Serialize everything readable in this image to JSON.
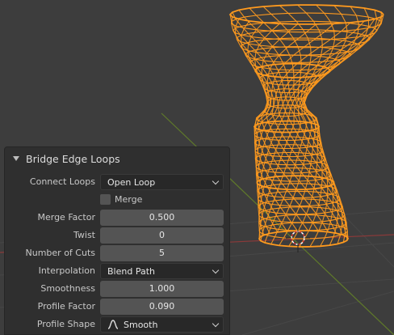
{
  "panel": {
    "title": "Bridge Edge Loops",
    "connect_loops": {
      "label": "Connect Loops",
      "value": "Open Loop"
    },
    "merge": {
      "label": "Merge",
      "checked": false
    },
    "merge_factor": {
      "label": "Merge Factor",
      "value": "0.500"
    },
    "twist": {
      "label": "Twist",
      "value": "0"
    },
    "number_of_cuts": {
      "label": "Number of Cuts",
      "value": "5"
    },
    "interpolation": {
      "label": "Interpolation",
      "value": "Blend Path"
    },
    "smoothness": {
      "label": "Smoothness",
      "value": "1.000"
    },
    "profile_factor": {
      "label": "Profile Factor",
      "value": "0.090"
    },
    "profile_shape": {
      "label": "Profile Shape",
      "value": "Smooth",
      "icon": "smooth-curve-icon"
    }
  },
  "colors": {
    "viewport_bg": "#3d3d3d",
    "mesh": "#ff9a1e",
    "axis_red": "#8a3a3a",
    "axis_green": "#5f7a2a"
  }
}
